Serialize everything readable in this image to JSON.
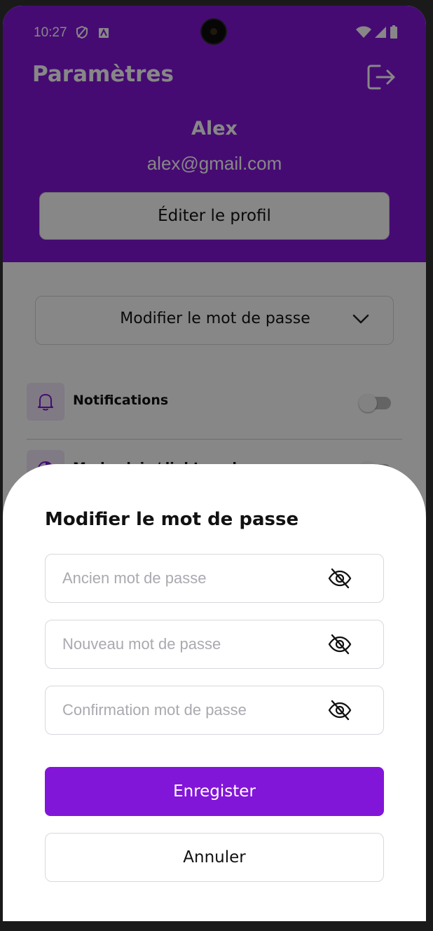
{
  "status_bar": {
    "time": "10:27"
  },
  "header": {
    "title": "Paramètres",
    "user_name": "Alex",
    "user_email": "alex@gmail.com",
    "edit_profile_label": "Éditer le profil",
    "logout_icon": "logout-icon"
  },
  "settings": {
    "change_password_label": "Modifier le mot de passe",
    "items": [
      {
        "label": "Notifications",
        "icon": "bell-icon",
        "enabled": false
      },
      {
        "label": "Mode clair / light mode",
        "icon": "half-moon-icon",
        "enabled": false
      }
    ]
  },
  "dialog": {
    "title": "Modifier le mot de passe",
    "fields": [
      {
        "placeholder": "Ancien mot de passe",
        "value": ""
      },
      {
        "placeholder": "Nouveau mot de passe",
        "value": ""
      },
      {
        "placeholder": "Confirmation mot de passe",
        "value": ""
      }
    ],
    "save_label": "Enregister",
    "cancel_label": "Annuler"
  },
  "colors": {
    "accent": "#8216d8",
    "sheet_background": "#ffffff",
    "placeholder": "#a9a9b0"
  }
}
